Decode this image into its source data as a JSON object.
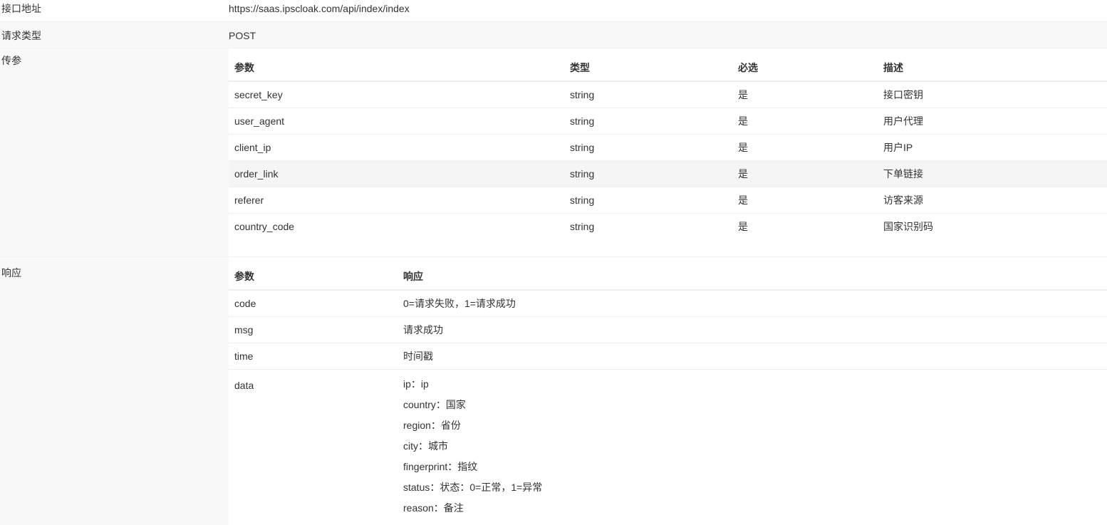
{
  "api": {
    "url_label": "接口地址",
    "url_value": "https://saas.ipscloak.com/api/index/index",
    "method_label": "请求类型",
    "method_value": "POST",
    "params_label": "传参",
    "response_label": "响应"
  },
  "params_table": {
    "headers": [
      "参数",
      "类型",
      "必选",
      "描述"
    ],
    "rows": [
      [
        "secret_key",
        "string",
        "是",
        "接口密钥"
      ],
      [
        "user_agent",
        "string",
        "是",
        "用户代理"
      ],
      [
        "client_ip",
        "string",
        "是",
        "用户IP"
      ],
      [
        "order_link",
        "string",
        "是",
        "下单链接"
      ],
      [
        "referer",
        "string",
        "是",
        "访客来源"
      ],
      [
        "country_code",
        "string",
        "是",
        "国家识别码"
      ]
    ]
  },
  "response_table": {
    "headers": [
      "参数",
      "响应"
    ],
    "rows": [
      [
        "code",
        "0=请求失败，1=请求成功"
      ],
      [
        "msg",
        "请求成功"
      ],
      [
        "time",
        "时间戳"
      ]
    ],
    "data_param": "data",
    "data_lines": [
      "ip：ip",
      "country：国家",
      "region：省份",
      "city：城市",
      "fingerprint：指纹",
      "status：状态：0=正常，1=异常",
      "reason：备注"
    ]
  }
}
